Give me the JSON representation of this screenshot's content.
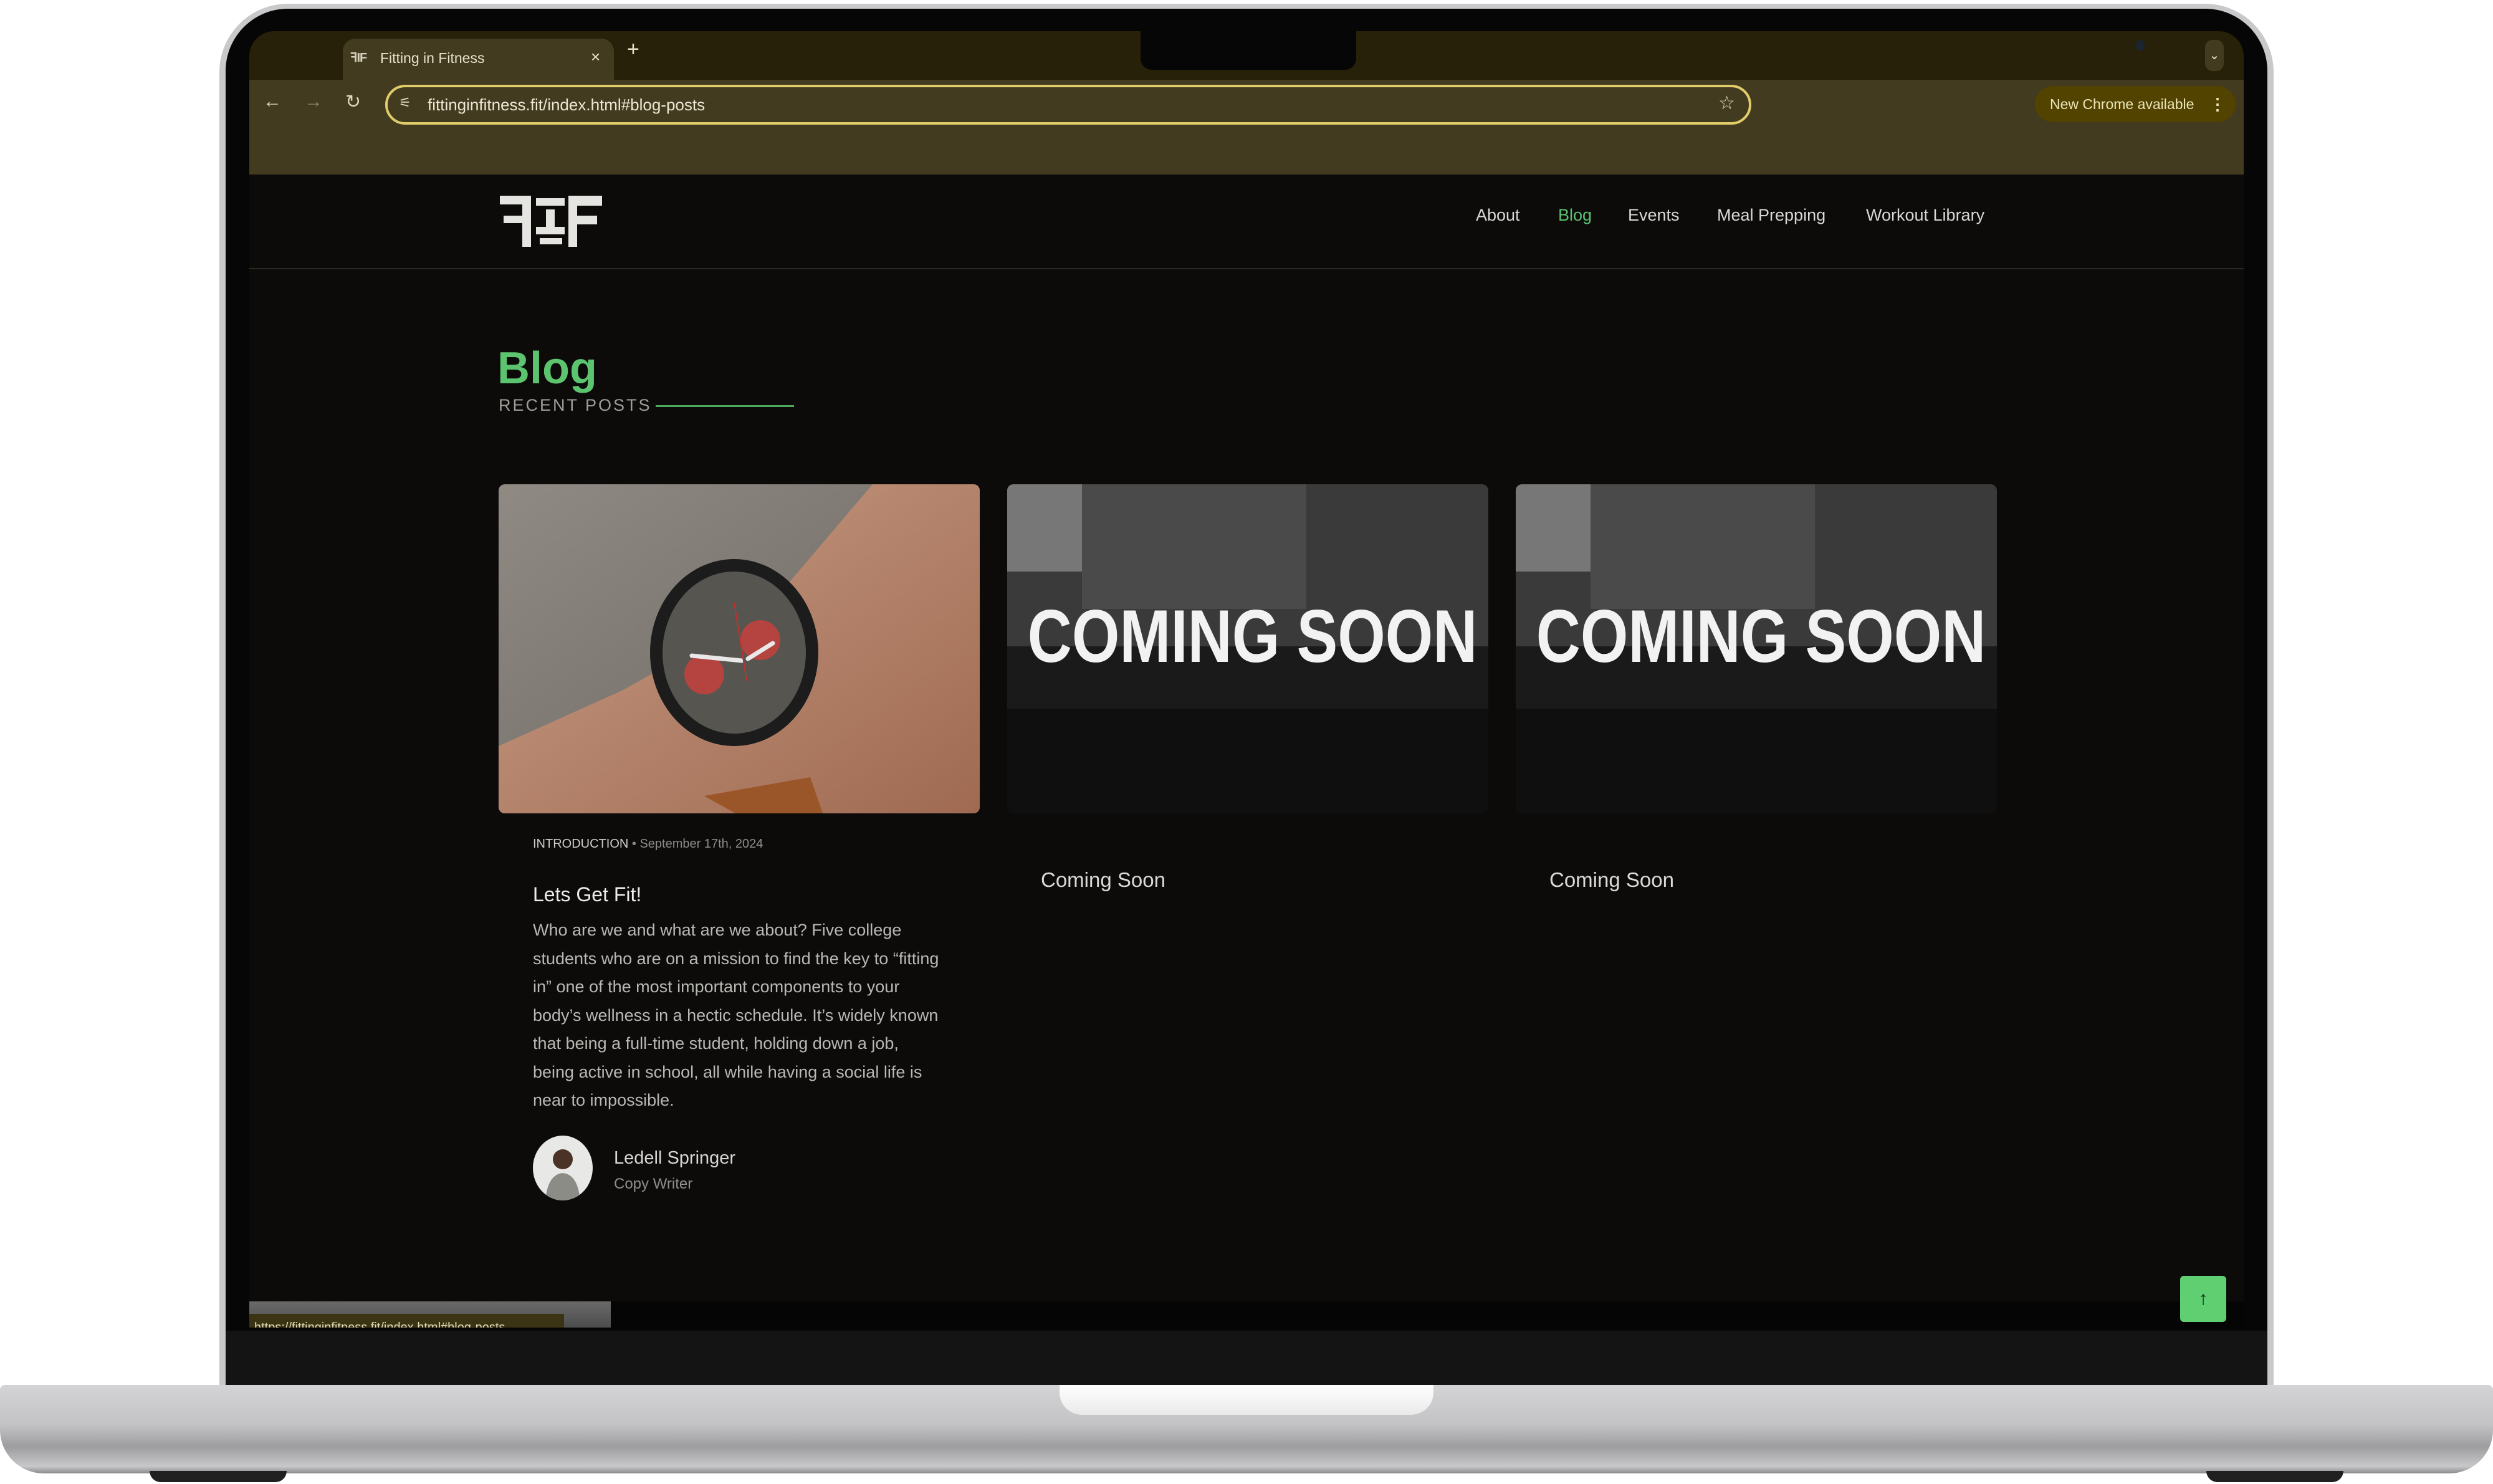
{
  "browser": {
    "tab": {
      "favicon": "fif-logo-icon",
      "title": "Fitting in Fitness",
      "close": "×"
    },
    "new_tab": "+",
    "tab_menu": "⌄",
    "nav": {
      "back": "←",
      "forward": "→",
      "reload": "↻"
    },
    "omnibox": {
      "site_info_icon": "⚟",
      "url": "fittinginfitness.fit/index.html#blog-posts",
      "bookmark_icon": "☆"
    },
    "update_button": {
      "label": "New Chrome available",
      "menu_icon": "⋮"
    },
    "status_url": "https://fittinginfitness.fit/index.html#blog-posts"
  },
  "site": {
    "logo_alt": "FIF",
    "nav": [
      {
        "label": "About",
        "active": false
      },
      {
        "label": "Blog",
        "active": true
      },
      {
        "label": "Events",
        "active": false
      },
      {
        "label": "Meal Prepping",
        "active": false
      },
      {
        "label": "Workout Library",
        "active": false
      }
    ],
    "accent_color": "#5cc46f"
  },
  "blog": {
    "title": "Blog",
    "subtitle": "RECENT POSTS",
    "posts": [
      {
        "category": "INTRODUCTION",
        "separator": " • ",
        "date": "September 17th, 2024",
        "title": "Lets Get Fit!",
        "excerpt": "Who are we and what are we about? Five college students who are on a mission to find the key to “fitting in” one of the most important components to your body’s wellness in a hectic schedule. It’s widely known that being a full-time student, holding down a job, being active in school, all while having a social life is near to impossible.",
        "author": {
          "name": "Ledell Springer",
          "role": "Copy Writer"
        },
        "image": "wristwatch-photo"
      },
      {
        "title": "Coming Soon",
        "image_text": "COMING SOON"
      },
      {
        "title": "Coming Soon",
        "image_text": "COMING SOON"
      }
    ]
  },
  "back_to_top": "↑"
}
